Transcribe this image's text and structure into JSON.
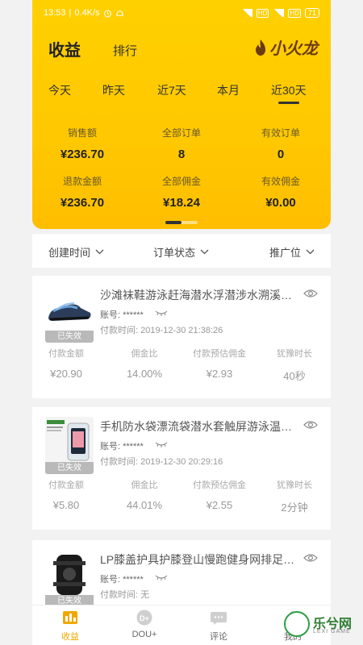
{
  "status_bar": {
    "time": "13:53",
    "speed": "0.4K/s",
    "hd1": "HD",
    "hd2": "HD",
    "battery": "71"
  },
  "header": {
    "title": "收益",
    "rank_tab": "排行",
    "brand": "小火龙"
  },
  "period_tabs": [
    "今天",
    "昨天",
    "近7天",
    "本月",
    "近30天"
  ],
  "active_period_index": 4,
  "stats": [
    {
      "label": "销售额",
      "value": "¥236.70"
    },
    {
      "label": "全部订单",
      "value": "8"
    },
    {
      "label": "有效订单",
      "value": "0"
    },
    {
      "label": "退款金额",
      "value": "¥236.70"
    },
    {
      "label": "全部佣金",
      "value": "¥18.24"
    },
    {
      "label": "有效佣金",
      "value": "¥0.00"
    }
  ],
  "filters": [
    "创建时间",
    "订单状态",
    "推广位"
  ],
  "metric_labels": [
    "付款金额",
    "佣金比",
    "付款预估佣金",
    "犹豫时长"
  ],
  "orders": [
    {
      "title": "沙滩袜鞋游泳赶海潜水浮潜涉水溯溪鞋...",
      "status": "已失效",
      "account": "账号: ******",
      "pay_time": "付款时间: 2019-12-30 21:38:26",
      "metrics": [
        "¥20.90",
        "14.00%",
        "¥2.93",
        "40秒"
      ]
    },
    {
      "title": "手机防水袋漂流袋潜水套触屏游泳温泉...",
      "status": "已失效",
      "account": "账号: ******",
      "pay_time": "付款时间: 2019-12-30 20:29:16",
      "metrics": [
        "¥5.80",
        "44.01%",
        "¥2.55",
        "2分钟"
      ]
    },
    {
      "title": "LP膝盖护具护膝登山慢跑健身网排足篮...",
      "status": "已失效",
      "account": "账号: ******",
      "pay_time": "付款时间: 无",
      "metrics": []
    }
  ],
  "bottom_nav": [
    {
      "label": "收益",
      "icon": "wallet-icon"
    },
    {
      "label": "DOU+",
      "icon": "dou-plus-icon"
    },
    {
      "label": "评论",
      "icon": "comment-icon"
    },
    {
      "label": "我的",
      "icon": "profile-icon"
    }
  ],
  "watermark": {
    "text": "乐兮网",
    "sub": "LEXI GAME"
  },
  "colors": {
    "accent": "#ffc800",
    "active_nav": "#f0a800"
  }
}
